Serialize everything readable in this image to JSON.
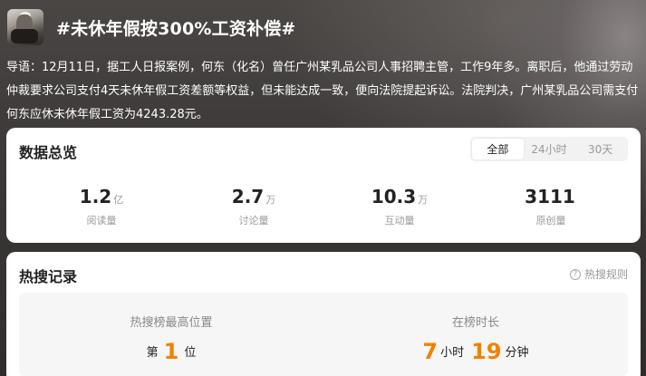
{
  "topic": {
    "title": "#未休年假按300%工资补偿#",
    "intro": "导语：12月11日，据工人日报案例，何东（化名）曾任广州某乳品公司人事招聘主管，工作9年多。离职后，他通过劳动仲裁要求公司支付4天未休年假工资差额等权益，但未能达成一致，便向法院提起诉讼。法院判决，广州某乳品公司需支付何东应休未休年假工资为4243.28元。"
  },
  "overview": {
    "title": "数据总览",
    "tabs": [
      "全部",
      "24小时",
      "30天"
    ],
    "active_tab": "全部",
    "stats": [
      {
        "value": "1.2",
        "unit": "亿",
        "label": "阅读量"
      },
      {
        "value": "2.7",
        "unit": "万",
        "label": "讨论量"
      },
      {
        "value": "10.3",
        "unit": "万",
        "label": "互动量"
      },
      {
        "value": "3111",
        "unit": "",
        "label": "原创量"
      }
    ]
  },
  "record": {
    "title": "热搜记录",
    "rules_label": "热搜规则",
    "peak_label": "热搜榜最高位置",
    "peak_prefix": "第",
    "peak_value": "1",
    "peak_suffix": "位",
    "duration_label": "在榜时长",
    "hours": "7",
    "hours_unit": "小时",
    "minutes": "19",
    "minutes_unit": "分钟"
  }
}
